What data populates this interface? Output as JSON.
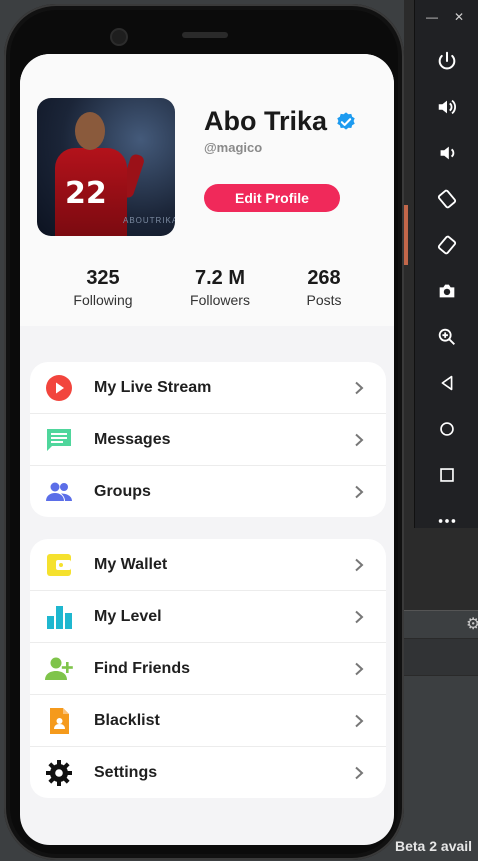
{
  "profile": {
    "name": "Abo Trika",
    "username": "@magico",
    "edit_label": "Edit Profile",
    "avatar_jersey_number": "22",
    "avatar_watermark": "ABOUTRIKA"
  },
  "stats": [
    {
      "value": "325",
      "label": "Following"
    },
    {
      "value": "7.2 M",
      "label": "Followers"
    },
    {
      "value": "268",
      "label": "Posts"
    }
  ],
  "menu_group_1": [
    {
      "label": "My Live Stream",
      "icon": "live-stream-icon",
      "color": "#f2453d"
    },
    {
      "label": "Messages",
      "icon": "messages-icon",
      "color": "#4fd69c"
    },
    {
      "label": "Groups",
      "icon": "groups-icon",
      "color": "#5b6ee8"
    }
  ],
  "menu_group_2": [
    {
      "label": "My Wallet",
      "icon": "wallet-icon",
      "color": "#f5e12e"
    },
    {
      "label": "My Level",
      "icon": "level-icon",
      "color": "#1fb7cf"
    },
    {
      "label": "Find Friends",
      "icon": "add-friend-icon",
      "color": "#7fc44a"
    },
    {
      "label": "Blacklist",
      "icon": "blacklist-icon",
      "color": "#f59a1c"
    },
    {
      "label": "Settings",
      "icon": "settings-icon",
      "color": "#111111"
    }
  ],
  "ide": {
    "status_text": "Beta 2 avail"
  },
  "colors": {
    "accent": "#f0295a",
    "verified": "#1d9bf0"
  }
}
